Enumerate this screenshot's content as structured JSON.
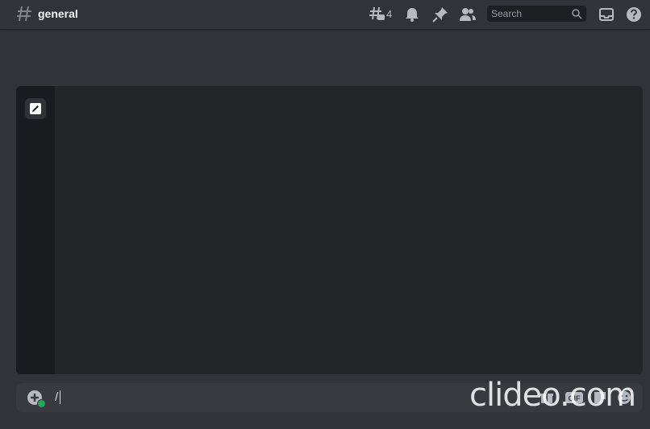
{
  "header": {
    "channel_icon": "hash-icon",
    "channel_name": "general",
    "threads_icon": "threads-icon",
    "thread_count": "4",
    "notification_icon": "bell-icon",
    "pin_icon": "pin-icon",
    "members_icon": "members-icon",
    "search": {
      "placeholder": "Search",
      "icon": "search-icon"
    },
    "inbox_icon": "inbox-icon",
    "help_icon": "help-icon"
  },
  "panel": {
    "edit_icon": "pencil-icon"
  },
  "composer": {
    "add_icon": "plus-circle-icon",
    "text": "/",
    "gift_icon": "gift-icon",
    "gif_label": "GIF",
    "sticker_icon": "sticker-icon",
    "emoji_icon": "emoji-icon"
  },
  "watermark": "clideo.com",
  "colors": {
    "background": "#313338",
    "panel": "#232528",
    "panel_side": "#1a1b1e",
    "composer": "#383a40",
    "accent_green": "#23a55a"
  }
}
